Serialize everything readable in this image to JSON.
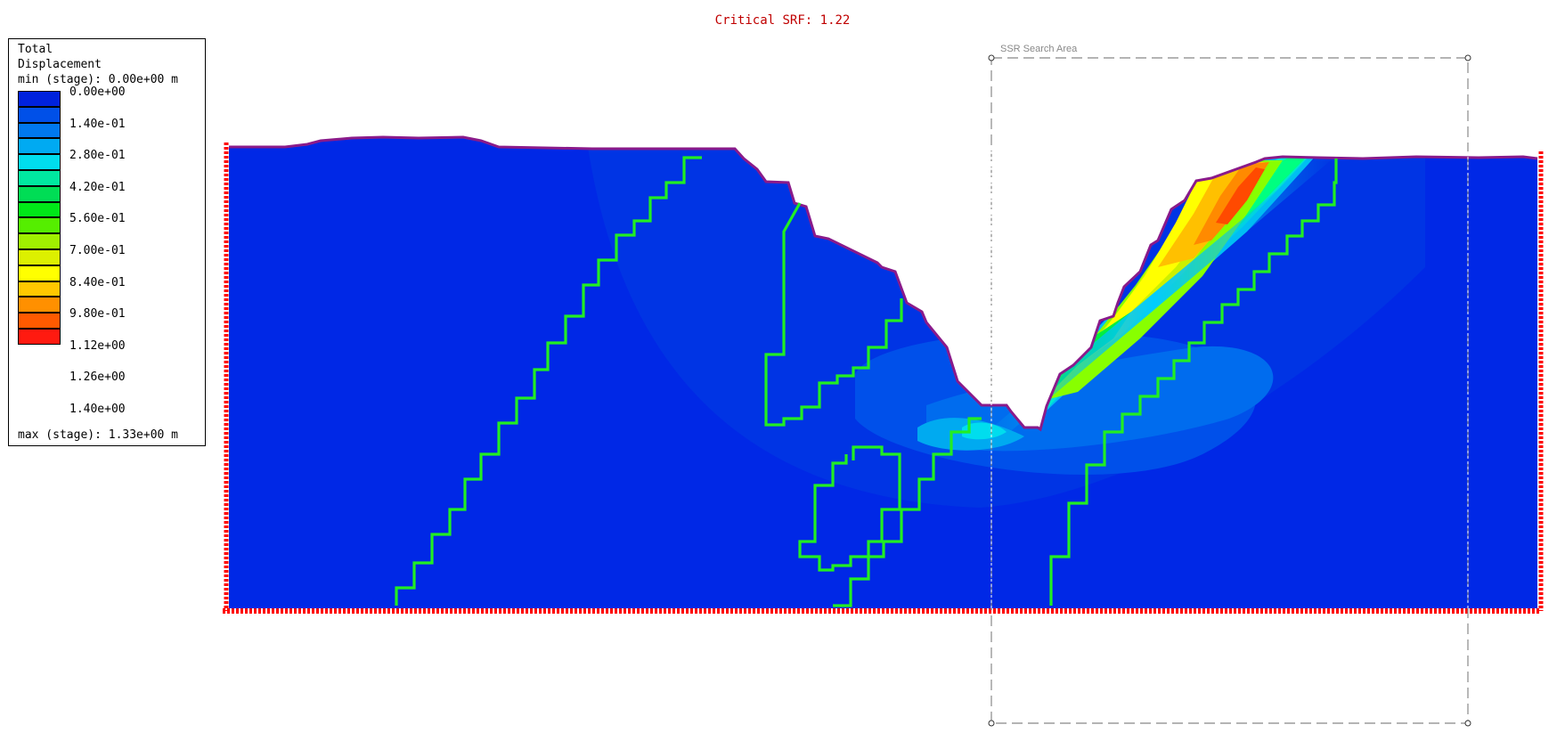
{
  "title": "Critical SRF: 1.22",
  "search_area_label": "SSR Search Area",
  "legend": {
    "title_line1": "Total",
    "title_line2": "Displacement",
    "min_label": "min (stage): 0.00e+00 m",
    "max_label": "max (stage): 1.33e+00 m",
    "ticks": [
      "0.00e+00",
      "1.40e-01",
      "2.80e-01",
      "4.20e-01",
      "5.60e-01",
      "7.00e-01",
      "8.40e-01",
      "9.80e-01",
      "1.12e+00",
      "1.26e+00",
      "1.40e+00"
    ],
    "swatch_colors": [
      "#0022dd",
      "#0050e8",
      "#0078ee",
      "#00aaf2",
      "#00ddee",
      "#00e8a0",
      "#00dd55",
      "#00e818",
      "#55ee00",
      "#a0f000",
      "#dcf000",
      "#ffff00",
      "#ffc800",
      "#ff9000",
      "#ff5a00",
      "#ff1a10"
    ]
  },
  "colors": {
    "background_blue": "#0028e6",
    "boundary": "#8a1a8a",
    "joints": "#22ee22",
    "support": "#ff0000",
    "search_box": "#888888"
  }
}
